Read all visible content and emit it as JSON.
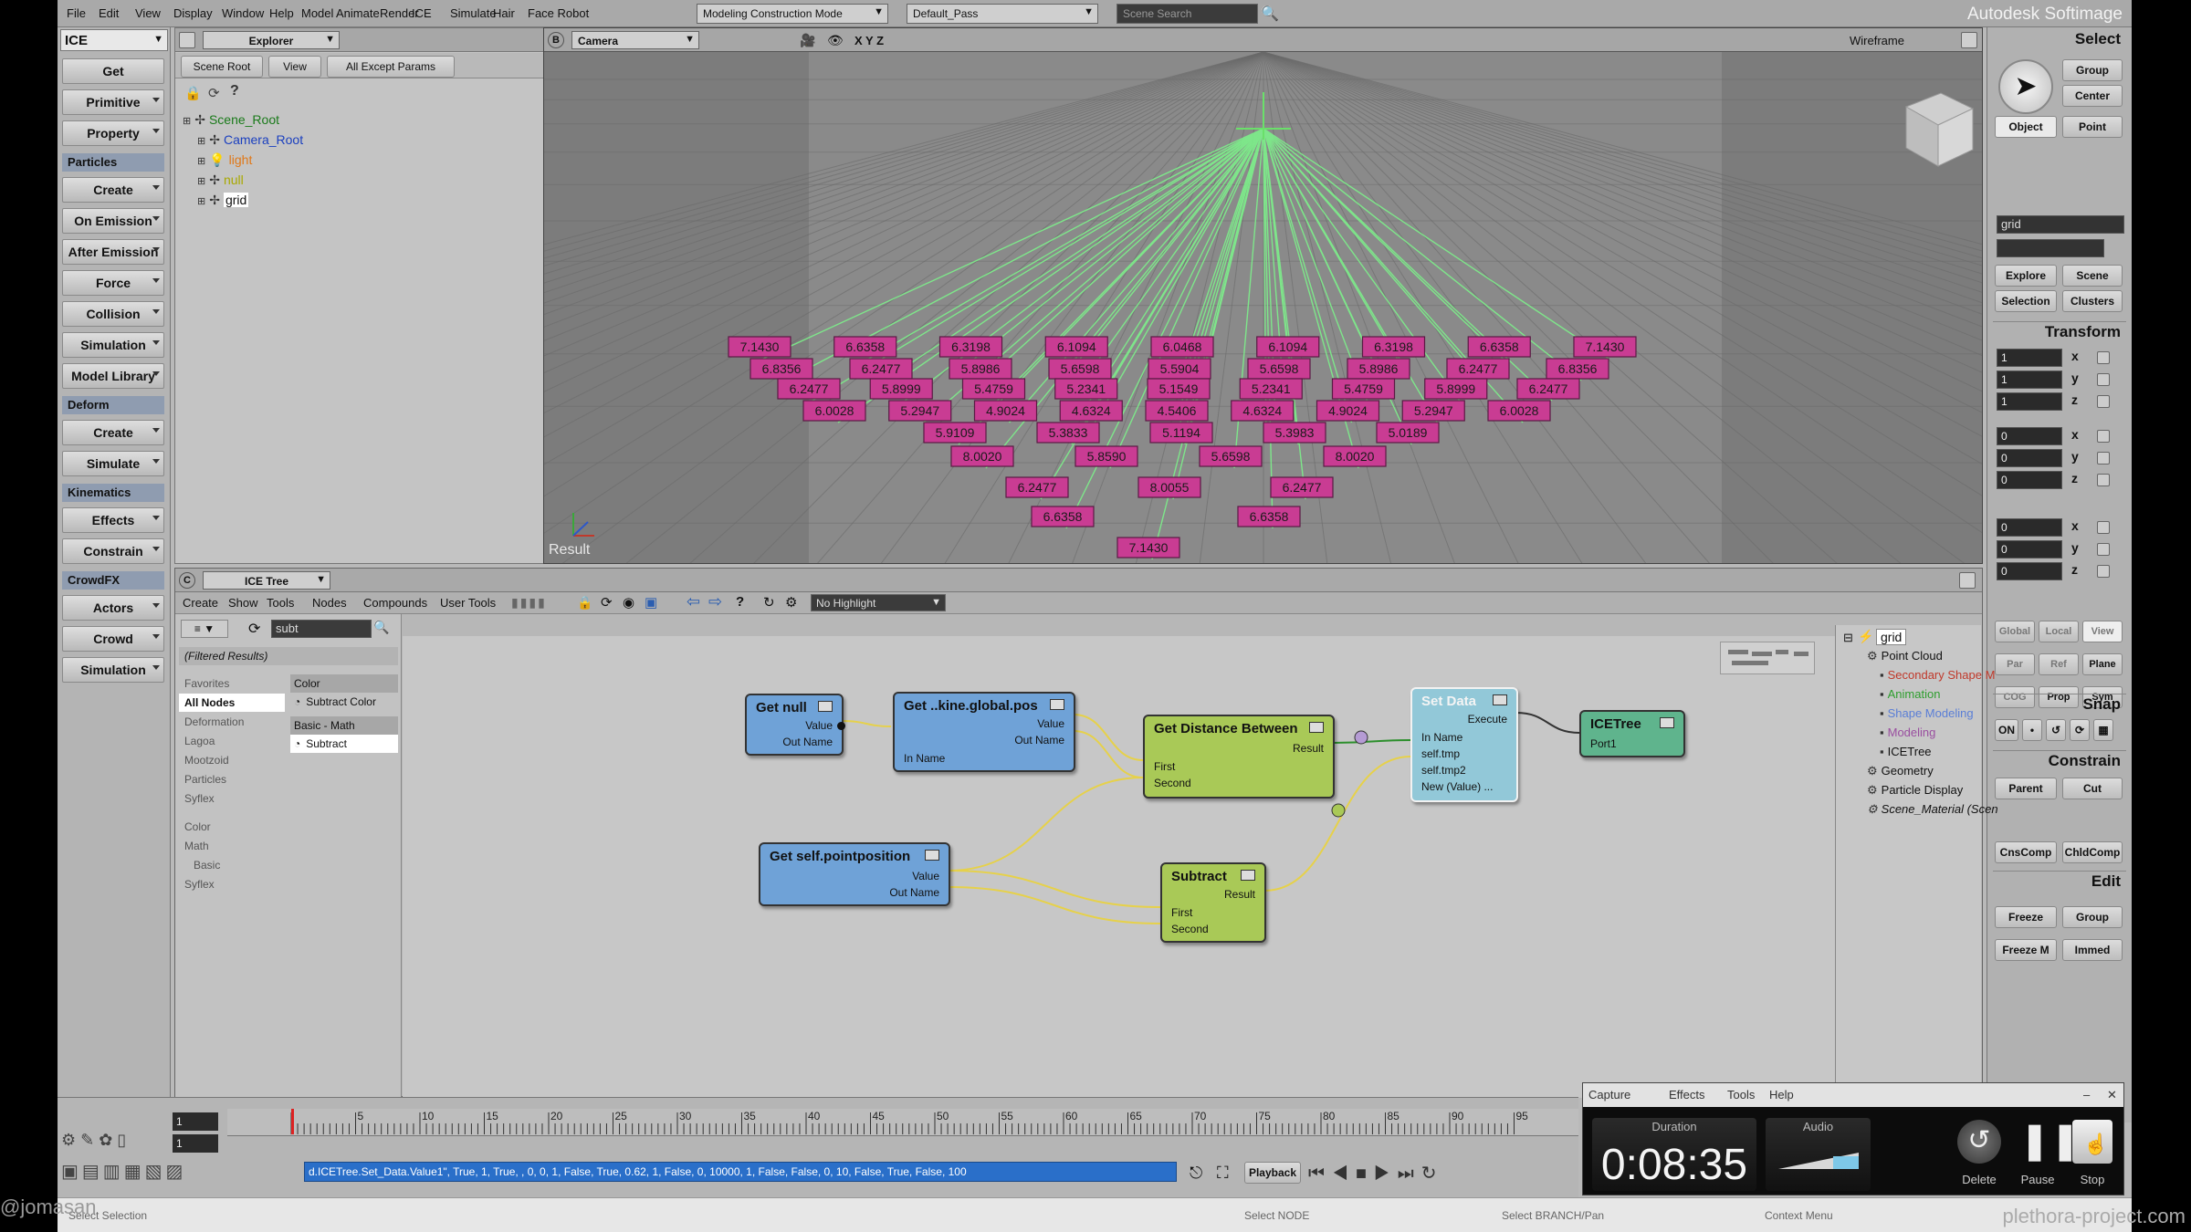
{
  "menubar": {
    "items": [
      "File",
      "Edit",
      "View",
      "Display",
      "Window",
      "Help",
      "Model",
      "Animate",
      "Render",
      "ICE",
      "Simulate",
      "Hair",
      "Face Robot"
    ],
    "mode_combo": "Modeling Construction Mode",
    "pass_combo": "Default_Pass",
    "search_placeholder": "Scene Search",
    "brand": "Autodesk Softimage"
  },
  "left_toolbar": {
    "module": "ICE",
    "items": [
      {
        "type": "button",
        "label": "Get"
      },
      {
        "type": "button",
        "label": "Primitive"
      },
      {
        "type": "button",
        "label": "Property"
      },
      {
        "type": "header",
        "label": "Particles"
      },
      {
        "type": "button",
        "label": "Create"
      },
      {
        "type": "button",
        "label": "On Emission"
      },
      {
        "type": "button",
        "label": "After Emission"
      },
      {
        "type": "button",
        "label": "Force"
      },
      {
        "type": "button",
        "label": "Collision"
      },
      {
        "type": "button",
        "label": "Simulation"
      },
      {
        "type": "button",
        "label": "Model Library"
      },
      {
        "type": "header",
        "label": "Deform"
      },
      {
        "type": "button",
        "label": "Create"
      },
      {
        "type": "button",
        "label": "Simulate"
      },
      {
        "type": "header",
        "label": "Kinematics"
      },
      {
        "type": "button",
        "label": "Effects"
      },
      {
        "type": "button",
        "label": "Constrain"
      },
      {
        "type": "header",
        "label": "CrowdFX"
      },
      {
        "type": "button",
        "label": "Actors"
      },
      {
        "type": "button",
        "label": "Crowd"
      },
      {
        "type": "button",
        "label": "Simulation"
      }
    ]
  },
  "explorer": {
    "title": "Explorer",
    "scope": "Scene Root",
    "view": "View",
    "filter": "All Except Params",
    "tree": [
      {
        "label": "Scene_Root",
        "color": "#1a7a1a"
      },
      {
        "label": "Camera_Root",
        "color": "#1a3fbf"
      },
      {
        "label": "light",
        "color": "#e07818"
      },
      {
        "label": "null",
        "color": "#a8a800"
      },
      {
        "label": "grid",
        "color": "#111111"
      }
    ]
  },
  "viewport": {
    "camera": "Camera",
    "axes_label": "X Y Z",
    "shading": "Wireframe",
    "result_label": "Result",
    "tags": [
      {
        "row": 0,
        "values": [
          "7.1430",
          "6.6358",
          "6.3198",
          "6.1094",
          "6.0468",
          "6.1094",
          "6.3198",
          "6.6358",
          "7.1430"
        ]
      },
      {
        "row": 1,
        "values": [
          "6.8356",
          "6.2477",
          "5.8986",
          "5.6598",
          "5.5904",
          "5.6598",
          "5.8986",
          "6.2477",
          "6.8356"
        ]
      },
      {
        "row": 2,
        "values": [
          "6.2477",
          "5.8999",
          "5.4759",
          "5.2341",
          "5.1549",
          "5.2341",
          "5.4759",
          "5.8999",
          "6.2477"
        ]
      },
      {
        "row": 3,
        "values": [
          "6.0028",
          "5.2947",
          "4.9024",
          "4.6324",
          "4.5406",
          "4.6324",
          "4.9024",
          "5.2947",
          "6.0028"
        ]
      },
      {
        "row": 4,
        "values": [
          "5.9109",
          "5.3833",
          "5.1194",
          "5.3983",
          "5.0189"
        ]
      },
      {
        "row": 5,
        "values": [
          "8.0020",
          "5.8590",
          "5.6598",
          "8.0020"
        ]
      },
      {
        "row": 6,
        "values": [
          "6.2477",
          "8.0055",
          "6.2477"
        ]
      },
      {
        "row": 7,
        "values": [
          "6.6358",
          "6.6358"
        ]
      },
      {
        "row": 8,
        "values": [
          "7.1430"
        ]
      }
    ]
  },
  "right_panel": {
    "select_title": "Select",
    "select_buttons": [
      "Group",
      "Center",
      "Object",
      "Point"
    ],
    "selection_name": "grid",
    "explore_buttons": [
      "Explore",
      "Scene",
      "Selection",
      "Clusters"
    ],
    "transform_title": "Transform",
    "scale": [
      "1",
      "1",
      "1"
    ],
    "rotate": [
      "0",
      "0",
      "0"
    ],
    "translate": [
      "0",
      "0",
      "0"
    ],
    "axis_labels": [
      "x",
      "y",
      "z"
    ],
    "space_buttons": [
      "Global",
      "Local",
      "View",
      "Par",
      "Ref",
      "Plane",
      "COG",
      "Prop",
      "Sym"
    ],
    "snap_title": "Snap",
    "snap_on": "ON",
    "constrain_title": "Constrain",
    "constrain_buttons": [
      "Parent",
      "Cut",
      "CnsComp",
      "ChldComp"
    ],
    "edit_title": "Edit",
    "edit_buttons": [
      "Freeze",
      "Group",
      "Freeze M",
      "Immed"
    ]
  },
  "ice_tree": {
    "title": "ICE Tree",
    "menu": [
      "Create",
      "Show",
      "Tools",
      "Nodes",
      "Compounds",
      "User Tools"
    ],
    "highlight": "No Highlight",
    "search_value": "subt",
    "filtered": "(Filtered Results)",
    "categories": [
      "Favorites",
      "All Nodes",
      "Deformation",
      "Lagoa",
      "Mootzoid",
      "Particles",
      "Syflex",
      "Color",
      "Math",
      "Basic",
      "Syflex"
    ],
    "results": [
      {
        "type": "header",
        "label": "Color"
      },
      {
        "type": "item",
        "label": "Subtract Color"
      },
      {
        "type": "header",
        "label": "Basic - Math"
      },
      {
        "type": "item",
        "label": "Subtract"
      }
    ],
    "nodes": {
      "get_null": {
        "title": "Get null",
        "ports": [
          "Value",
          "Out Name"
        ]
      },
      "get_kine": {
        "title": "Get ..kine.global.pos",
        "ports": [
          "Value",
          "Out Name",
          "In Name"
        ]
      },
      "get_dist": {
        "title": "Get Distance Between",
        "ports": [
          "Result",
          "First",
          "Second"
        ]
      },
      "get_point": {
        "title": "Get self.pointposition",
        "ports": [
          "Value",
          "Out Name"
        ]
      },
      "subtract": {
        "title": "Subtract",
        "ports": [
          "Result",
          "First",
          "Second"
        ]
      },
      "set_data": {
        "title": "Set Data",
        "ports": [
          "Execute",
          "In Name",
          "self.tmp",
          "self.tmp2",
          "New (Value) ..."
        ]
      },
      "icetree": {
        "title": "ICETree",
        "ports": [
          "Port1"
        ]
      }
    },
    "scene_tree": {
      "root": "grid",
      "items": [
        {
          "label": "Point Cloud",
          "color": "#111111",
          "indent": 1
        },
        {
          "label": "Secondary Shape M",
          "color": "#c0392b",
          "indent": 2
        },
        {
          "label": "Animation",
          "color": "#2e9e2e",
          "indent": 2
        },
        {
          "label": "Shape Modeling",
          "color": "#5a7ed6",
          "indent": 2
        },
        {
          "label": "Modeling",
          "color": "#9a4fa0",
          "indent": 2
        },
        {
          "label": "ICETree",
          "color": "#111111",
          "indent": 2
        },
        {
          "label": "Geometry",
          "color": "#111111",
          "indent": 1
        },
        {
          "label": "Particle Display",
          "color": "#111111",
          "indent": 1
        },
        {
          "label": "Scene_Material (Scen",
          "color": "#111111",
          "indent": 1
        }
      ]
    }
  },
  "timeline": {
    "start_frame": "1",
    "current_frame": "1",
    "ticks": [
      "5",
      "10",
      "15",
      "20",
      "25",
      "30",
      "35",
      "40",
      "45",
      "50",
      "55",
      "60",
      "65",
      "70",
      "75",
      "80",
      "85",
      "90",
      "95"
    ],
    "script_line": "d.ICETree.Set_Data.Value1\", True, 1, True, , 0, 0, 1, False, True, 0.62, 1, False, 0, 10000, 1, False, False, 0, 10, False, True, False, 100",
    "playback_label": "Playback"
  },
  "status_bar": {
    "left": "Select Selection",
    "hint1": "Select NODE",
    "hint2": "Select BRANCH/Pan",
    "hint3": "Context Menu"
  },
  "capture": {
    "menu": [
      "Capture",
      "Effects",
      "Tools",
      "Help"
    ],
    "duration_label": "Duration",
    "duration": "0:08:35",
    "audio_label": "Audio",
    "delete_label": "Delete",
    "pause_label": "Pause",
    "stop_label": "Stop"
  },
  "watermark_left": "@jomasan",
  "watermark_right": "plethora-project.com"
}
